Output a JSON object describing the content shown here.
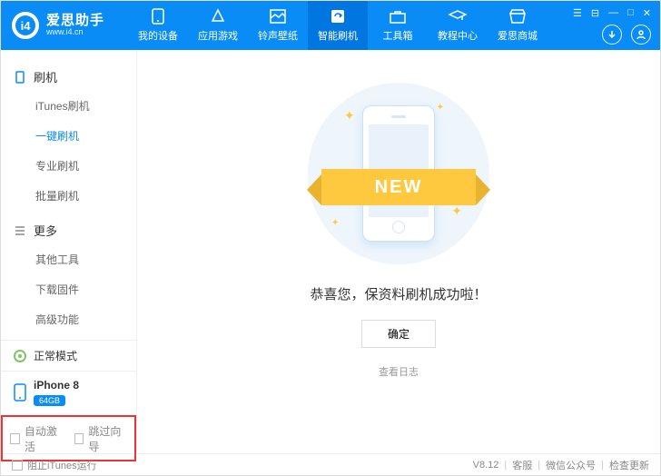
{
  "appTitle": "爱思助手",
  "appSub": "www.i4.cn",
  "logoMark": "i4",
  "nav": [
    {
      "label": "我的设备"
    },
    {
      "label": "应用游戏"
    },
    {
      "label": "铃声壁纸"
    },
    {
      "label": "智能刷机"
    },
    {
      "label": "工具箱"
    },
    {
      "label": "教程中心"
    },
    {
      "label": "爱思商城"
    }
  ],
  "sidebar": {
    "flash": {
      "title": "刷机",
      "items": [
        "iTunes刷机",
        "一键刷机",
        "专业刷机",
        "批量刷机"
      ],
      "activeIndex": 1
    },
    "more": {
      "title": "更多",
      "items": [
        "其他工具",
        "下载固件",
        "高级功能"
      ]
    },
    "modeLabel": "正常模式",
    "deviceName": "iPhone 8",
    "deviceStorage": "64GB",
    "autoActivate": "自动激活",
    "skipGuide": "跳过向导"
  },
  "main": {
    "ribbon": "NEW",
    "message": "恭喜您，保资料刷机成功啦！",
    "okLabel": "确定",
    "logLabel": "查看日志"
  },
  "statusbar": {
    "blockItunes": "阻止iTunes运行",
    "version": "V8.12",
    "links": [
      "客服",
      "微信公众号",
      "检查更新"
    ]
  }
}
